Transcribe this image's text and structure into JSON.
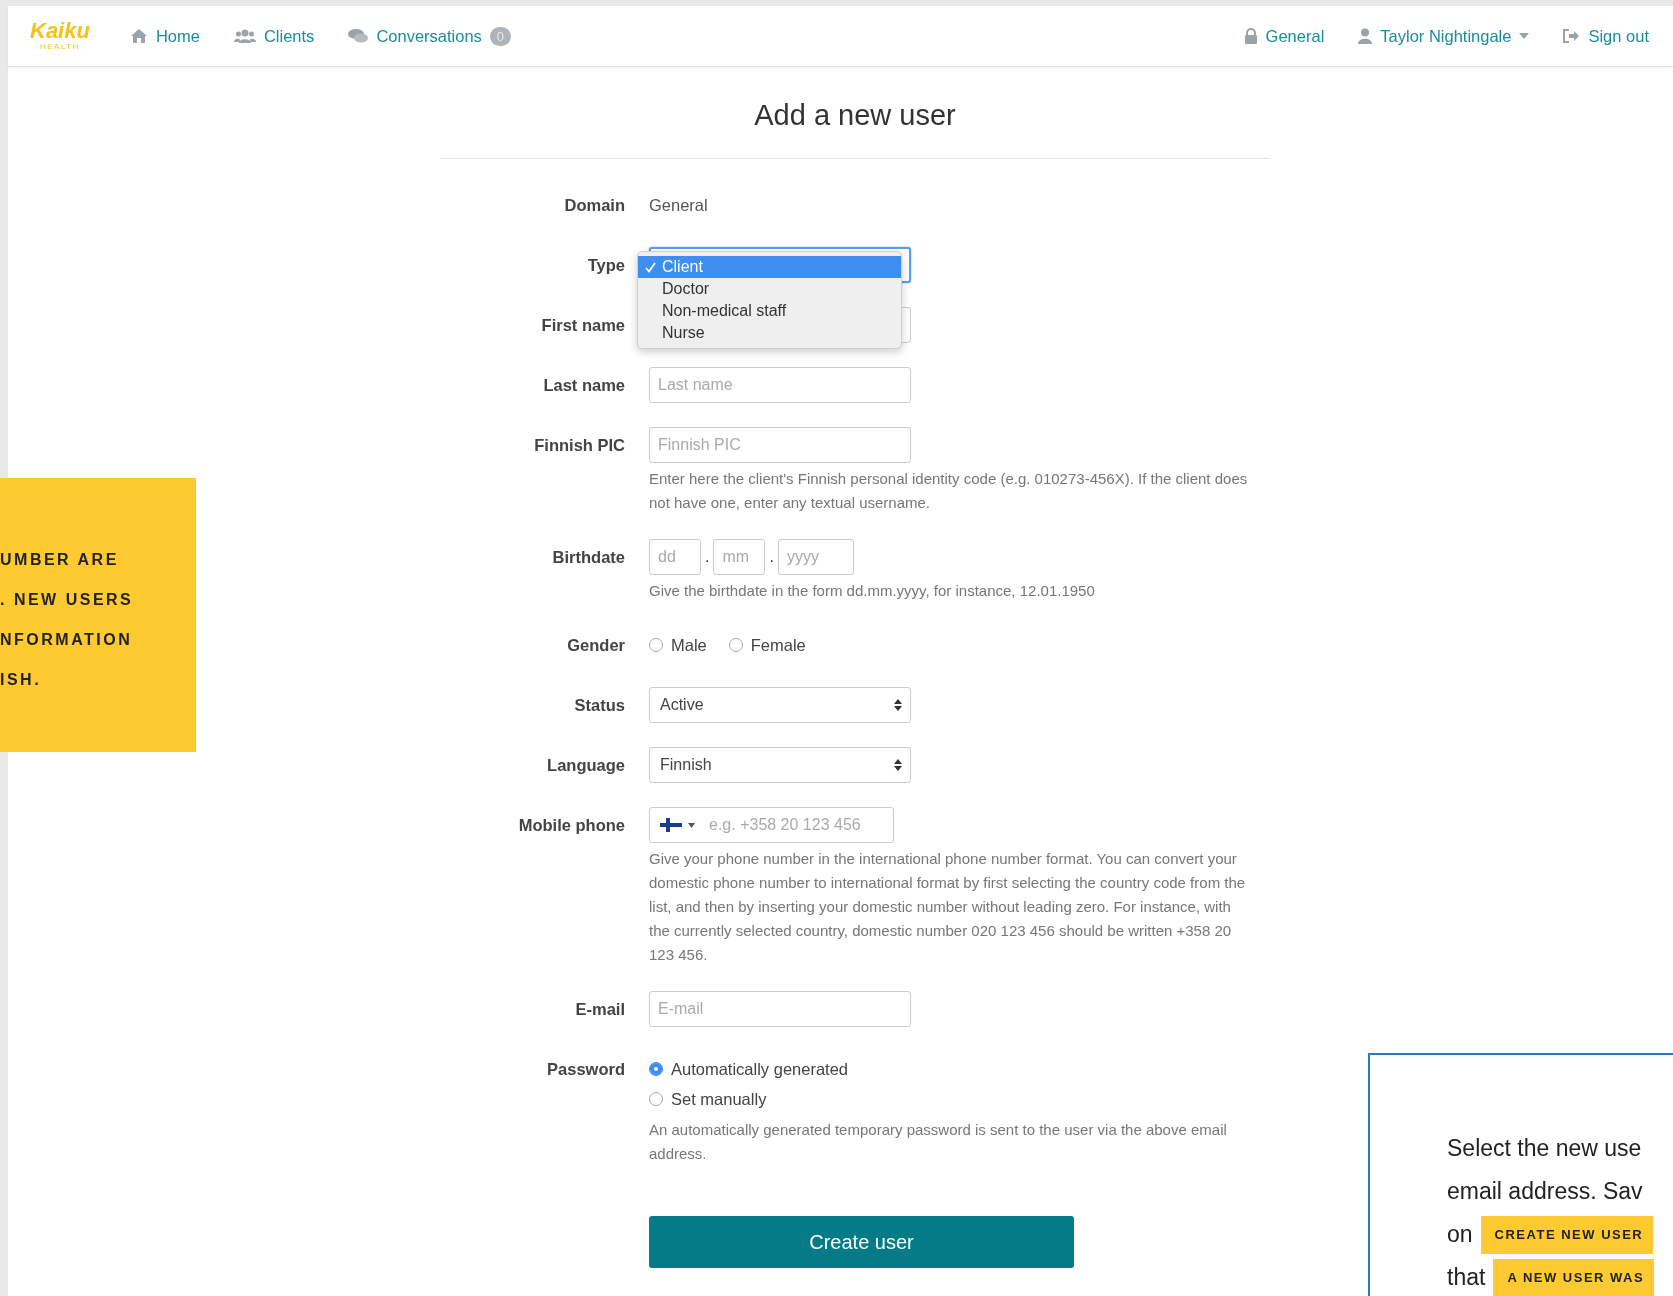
{
  "nav": {
    "logo": "Kaiku",
    "logo_sub": "HEALTH",
    "links": [
      {
        "label": "Home",
        "kind": "home"
      },
      {
        "label": "Clients",
        "kind": "clients"
      },
      {
        "label": "Conversations",
        "kind": "chat",
        "badge": "0"
      }
    ],
    "right": [
      {
        "label": "General",
        "kind": "lock"
      },
      {
        "label": "Taylor Nightingale",
        "kind": "user-menu"
      },
      {
        "label": "Sign out",
        "kind": "signout"
      }
    ]
  },
  "title": "Add a new user",
  "fields": [
    {
      "kind": "static",
      "label": "Domain",
      "value": "General"
    },
    {
      "kind": "dropdown",
      "label": "Type",
      "options": [
        {
          "label": "Client",
          "selected": true
        },
        {
          "label": "Doctor",
          "selected": false
        },
        {
          "label": "Non-medical staff",
          "selected": false
        },
        {
          "label": "Nurse",
          "selected": false
        }
      ]
    },
    {
      "kind": "covered",
      "label": "First name"
    },
    {
      "kind": "text",
      "label": "Last name",
      "placeholder": "Last name"
    },
    {
      "kind": "text",
      "label": "Finnish PIC",
      "placeholder": "Finnish PIC",
      "help": "Enter here the client's Finnish personal identity code (e.g. 010273-456X). If the client does not have one, enter any textual username."
    },
    {
      "kind": "date",
      "label": "Birthdate",
      "parts": [
        {
          "placeholder": "dd",
          "sep": "."
        },
        {
          "placeholder": "mm",
          "sep": "."
        },
        {
          "placeholder": "yyyy"
        }
      ],
      "help": "Give the birthdate in the form dd.mm.yyyy, for instance, 12.01.1950"
    },
    {
      "kind": "radio-inline",
      "label": "Gender",
      "options": [
        {
          "label": "Male",
          "selected": false
        },
        {
          "label": "Female",
          "selected": false
        }
      ]
    },
    {
      "kind": "select",
      "label": "Status",
      "value": "Active"
    },
    {
      "kind": "select",
      "label": "Language",
      "value": "Finnish"
    },
    {
      "kind": "phone",
      "label": "Mobile phone",
      "placeholder": "e.g. +358 20 123 456",
      "help": "Give your phone number in the international phone number format. You can convert your domestic phone number to international format by first selecting the country code from the list, and then by inserting your domestic number without leading zero. For instance, with the currently selected country, domestic number 020 123 456 should be written +358 20 123 456."
    },
    {
      "kind": "text",
      "label": "E-mail",
      "placeholder": "E-mail"
    },
    {
      "kind": "radio",
      "label": "Password",
      "options": [
        {
          "label": "Automatically generated",
          "selected": true
        },
        {
          "label": "Set manually",
          "selected": false
        }
      ],
      "help": "An automatically generated temporary password is sent to the user via the above email address."
    }
  ],
  "submit": "Create user",
  "left_callout": {
    "lines": [
      "UMBER ARE",
      ". NEW USERS",
      "NFORMATION",
      "ISH."
    ]
  },
  "right_callout": {
    "lines": [
      {
        "text": "Select the new use"
      },
      {
        "text": "email address. Sav"
      },
      {
        "text": "on",
        "badge": "CREATE NEW USER"
      },
      {
        "text": "that",
        "badge": "A NEW USER WAS"
      }
    ]
  }
}
